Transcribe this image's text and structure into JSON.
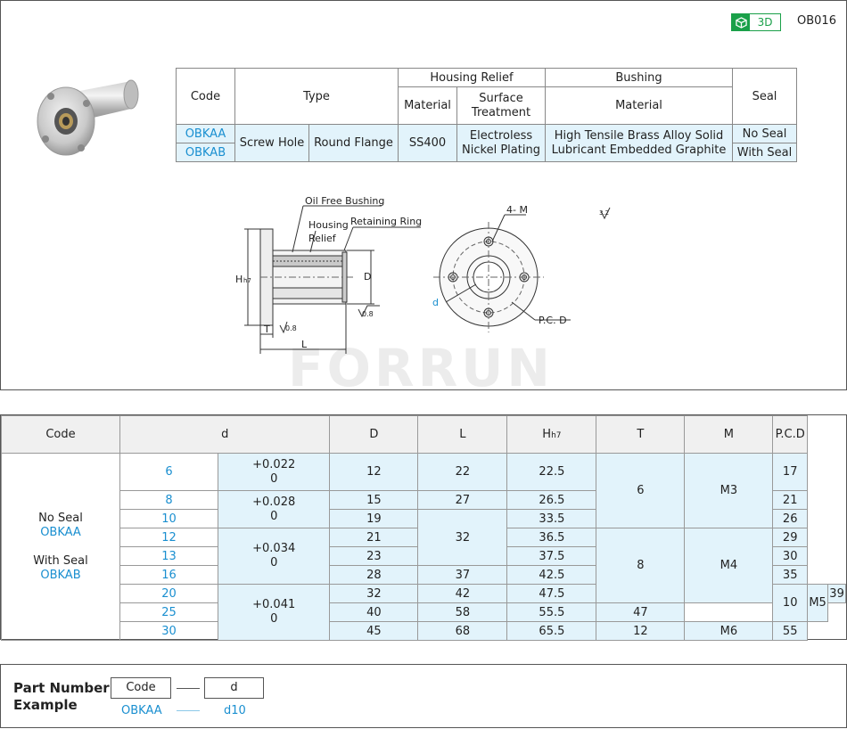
{
  "header": {
    "badge_label": "3D",
    "part_code": "OB016"
  },
  "type_table": {
    "col_code": "Code",
    "col_type": "Type",
    "col_housing_relief": "Housing Relief",
    "col_material": "Material",
    "col_surface": "Surface Treatment",
    "col_bushing": "Bushing",
    "col_bushing_material": "Material",
    "col_seal": "Seal",
    "code_a": "OBKAA",
    "code_b": "OBKAB",
    "type_1": "Screw Hole",
    "type_2": "Round Flange",
    "housing_material": "SS400",
    "surface_line1": "Electroless",
    "surface_line2": "Nickel Plating",
    "bushing_line1": "High Tensile Brass Alloy Solid",
    "bushing_line2": "Lubricant Embedded Graphite",
    "seal_a": "No Seal",
    "seal_b": "With Seal"
  },
  "drawing": {
    "label_oil_free": "Oil Free Bushing",
    "label_housing": "Housing",
    "label_relief": "Relief",
    "label_retaining": "Retaining Ring",
    "label_h": "H",
    "label_h_sub": "h7",
    "label_d": "D",
    "label_t": "T",
    "label_l": "L",
    "label_m": "4- M",
    "label_small_d": "d",
    "label_pcd": "P.C. D",
    "rough_08a": "0.8",
    "rough_08b": "0.8",
    "rough_32": "3.2",
    "watermark": "FORRUN"
  },
  "spec_table": {
    "headers": {
      "code": "Code",
      "d": "d",
      "D": "D",
      "L": "L",
      "H": "H",
      "H_sub": "h7",
      "T": "T",
      "M": "M",
      "PCD": "P.C.D"
    },
    "code_cell": {
      "no_seal": "No Seal",
      "code_a": "OBKAA",
      "with_seal": "With Seal",
      "code_b": "OBKAB"
    },
    "tol": [
      {
        "plus": "+0.022",
        "zero": "0"
      },
      {
        "plus": "+0.028",
        "zero": "0"
      },
      {
        "plus": "+0.034",
        "zero": "0"
      },
      {
        "plus": "+0.041",
        "zero": "0"
      }
    ],
    "rows": [
      {
        "d": "6",
        "D": "12",
        "L": "22",
        "H": "22.5",
        "PCD": "17"
      },
      {
        "d": "8",
        "D": "15",
        "L": "27",
        "H": "26.5",
        "PCD": "21"
      },
      {
        "d": "10",
        "D": "19",
        "L": "",
        "H": "33.5",
        "PCD": "26"
      },
      {
        "d": "12",
        "D": "21",
        "L": "32",
        "H": "36.5",
        "PCD": "29"
      },
      {
        "d": "13",
        "D": "23",
        "L": "",
        "H": "37.5",
        "PCD": "30"
      },
      {
        "d": "16",
        "D": "28",
        "L": "37",
        "H": "42.5",
        "PCD": "35"
      },
      {
        "d": "20",
        "D": "32",
        "L": "42",
        "H": "47.5",
        "PCD": "39"
      },
      {
        "d": "25",
        "D": "40",
        "L": "58",
        "H": "55.5",
        "PCD": "47"
      },
      {
        "d": "30",
        "D": "45",
        "L": "68",
        "H": "65.5",
        "PCD": "55"
      }
    ],
    "T": [
      "6",
      "8",
      "10",
      "12"
    ],
    "M": [
      "M3",
      "M4",
      "M5",
      "M6"
    ]
  },
  "part_number": {
    "title_line1": "Part Number",
    "title_line2": "Example",
    "box_code": "Code",
    "box_d": "d",
    "example_code": "OBKAA",
    "example_d": "d10"
  },
  "colors": {
    "accent_blue": "#1a8fd0",
    "cell_blue": "#e2f3fb",
    "badge_green": "#1aa049"
  }
}
